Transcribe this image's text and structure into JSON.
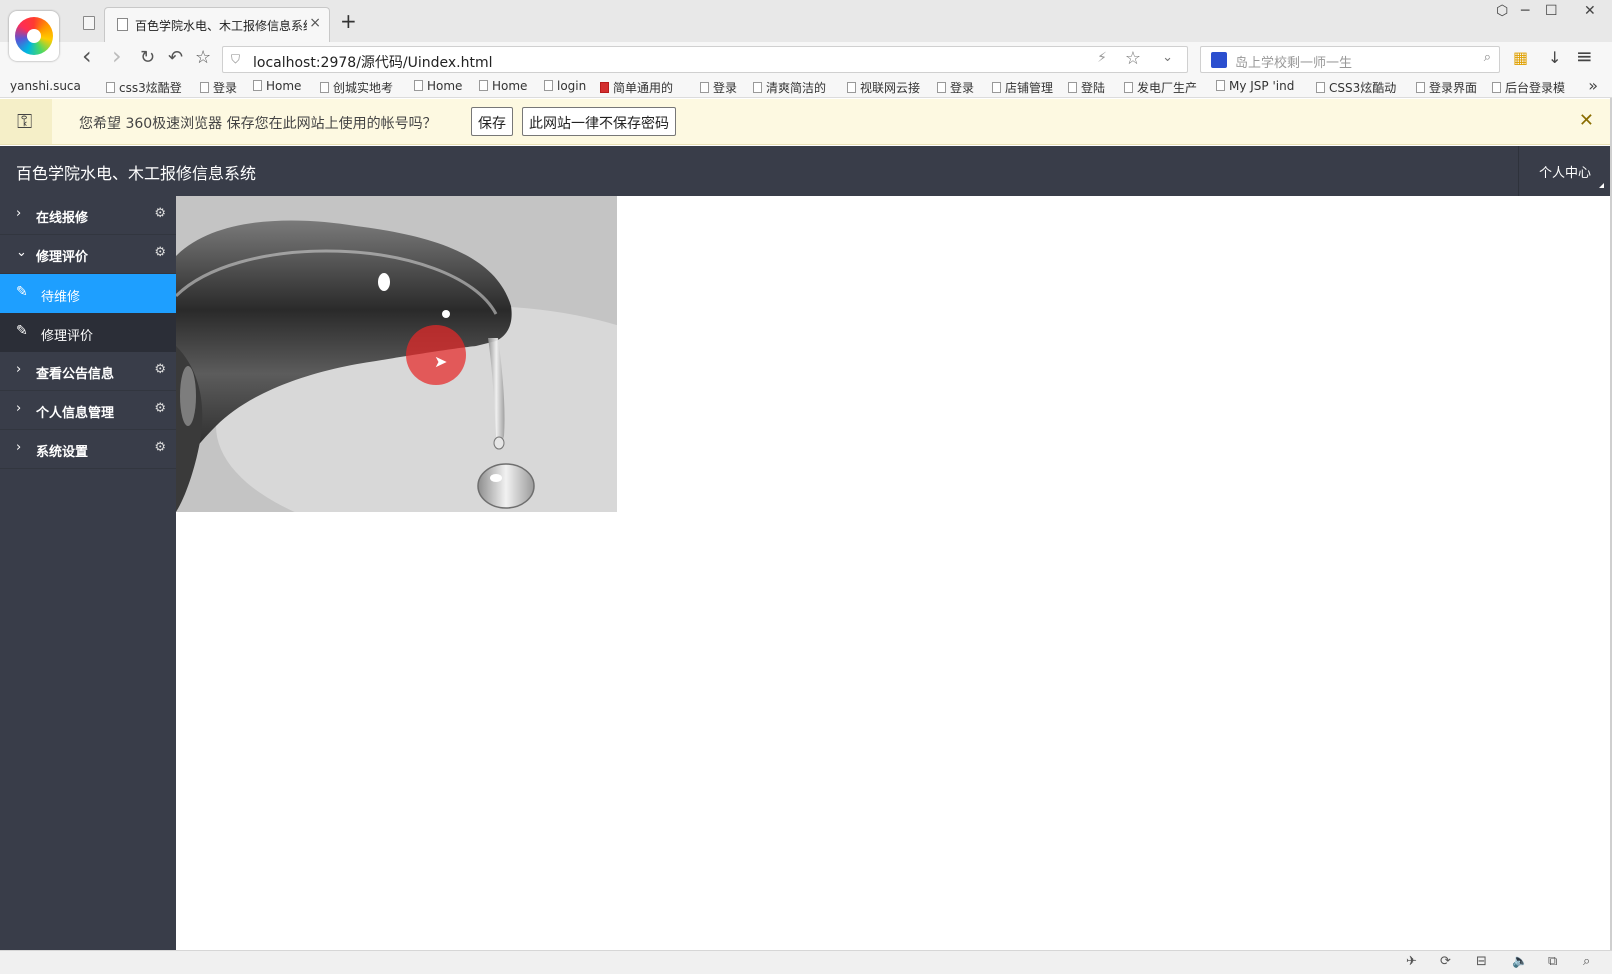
{
  "browser": {
    "tab_title": "百色学院水电、木工报修信息系统",
    "tab_close": "×",
    "new_tab": "+",
    "window_controls": [
      "⬡",
      "─",
      "☐",
      "✕"
    ],
    "nav": {
      "back": "‹",
      "forward": "›",
      "reload": "↻",
      "undo": "↶",
      "favorite": "☆"
    },
    "address": {
      "url": "localhost:2978/源代码/Uindex.html",
      "shield": "⛉",
      "bolt": "⚡",
      "star": "☆",
      "dropdown": "⌄"
    },
    "search": {
      "text": "岛上学校剩一师一生",
      "icon": "⌕"
    },
    "tools": {
      "apps": "▦",
      "download": "↓",
      "menu": "≡"
    },
    "bookmarks": [
      {
        "label": "yanshi.suca",
        "icon": "none"
      },
      {
        "label": "css3炫酷登",
        "icon": "page"
      },
      {
        "label": "登录",
        "icon": "page"
      },
      {
        "label": "Home",
        "icon": "page"
      },
      {
        "label": "创城实地考",
        "icon": "page"
      },
      {
        "label": "Home",
        "icon": "page"
      },
      {
        "label": "Home",
        "icon": "page"
      },
      {
        "label": "login",
        "icon": "page"
      },
      {
        "label": "简单通用的",
        "icon": "red"
      },
      {
        "label": "登录",
        "icon": "page"
      },
      {
        "label": "清爽简洁的",
        "icon": "page"
      },
      {
        "label": "视联网云接",
        "icon": "page"
      },
      {
        "label": "登录",
        "icon": "page"
      },
      {
        "label": "店铺管理",
        "icon": "page"
      },
      {
        "label": "登陆",
        "icon": "page"
      },
      {
        "label": "发电厂生产",
        "icon": "page"
      },
      {
        "label": "My JSP 'ind",
        "icon": "page"
      },
      {
        "label": "CSS3炫酷动",
        "icon": "page"
      },
      {
        "label": "登录界面",
        "icon": "page"
      },
      {
        "label": "后台登录模",
        "icon": "page"
      }
    ],
    "bookmarks_more": "»",
    "password_bar": {
      "message": "您希望 360极速浏览器 保存您在此网站上使用的帐号吗？",
      "save_label": "保存",
      "never_label": "此网站一律不保存密码",
      "close": "✕"
    },
    "status_icons": [
      "✈",
      "⟳",
      "⊟",
      "🔈",
      "⧉",
      "⌕"
    ]
  },
  "app": {
    "title": "百色学院水电、木工报修信息系统",
    "user_center": "个人中心",
    "sidebar": {
      "groups": [
        {
          "label": "在线报修",
          "expanded": false,
          "children": []
        },
        {
          "label": "修理评价",
          "expanded": true,
          "children": [
            {
              "label": "待维修",
              "active": true
            },
            {
              "label": "修理评价",
              "active": false
            }
          ]
        },
        {
          "label": "查看公告信息",
          "expanded": false,
          "children": []
        },
        {
          "label": "个人信息管理",
          "expanded": false,
          "children": []
        },
        {
          "label": "系统设置",
          "expanded": false,
          "children": []
        }
      ],
      "chevron_collapsed": "›",
      "chevron_expanded": "⌄",
      "gear": "⚙",
      "pencil": "✎"
    },
    "main": {
      "image_subject": "faucet-with-water-drop"
    },
    "colors": {
      "header": "#393d49",
      "active_item": "#1e9fff",
      "child_bg": "#2b2e37"
    }
  }
}
